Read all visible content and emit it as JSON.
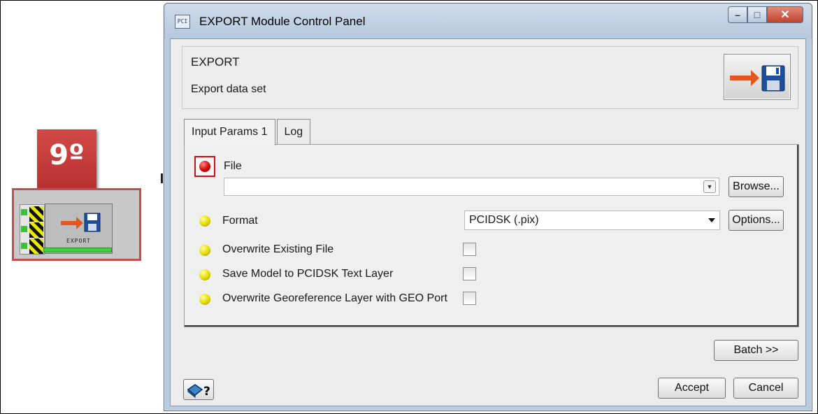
{
  "step_badge": {
    "label": "9º"
  },
  "module_node": {
    "label": "EXPORT"
  },
  "window": {
    "title": "EXPORT Module Control Panel",
    "controls": {
      "minimize": "–",
      "maximize": "□",
      "close": "✕"
    }
  },
  "header": {
    "module_name": "EXPORT",
    "description": "Export data set",
    "run_icon": "export-disk-icon"
  },
  "tabs": [
    {
      "label": "Input Params 1",
      "active": true
    },
    {
      "label": "Log",
      "active": false
    }
  ],
  "params": {
    "file": {
      "label": "File",
      "value": "",
      "status": "required-red",
      "browse_label": "Browse..."
    },
    "format": {
      "label": "Format",
      "value": "PCIDSK (.pix)",
      "options_label": "Options...",
      "status": "yellow"
    },
    "checkboxes": [
      {
        "label": "Overwrite Existing File",
        "checked": false
      },
      {
        "label": "Save Model to PCIDSK Text Layer",
        "checked": false
      },
      {
        "label": "Overwrite Georeference Layer with GEO Port",
        "checked": false
      }
    ]
  },
  "buttons": {
    "batch": "Batch >>",
    "accept": "Accept",
    "cancel": "Cancel",
    "help_icon": "help-book-icon"
  },
  "colors": {
    "badge": "#c0504d",
    "led_red": "#d40000",
    "led_yellow": "#e2dc00",
    "titlebar": "#c6d6e8",
    "progress": "#40d040"
  }
}
